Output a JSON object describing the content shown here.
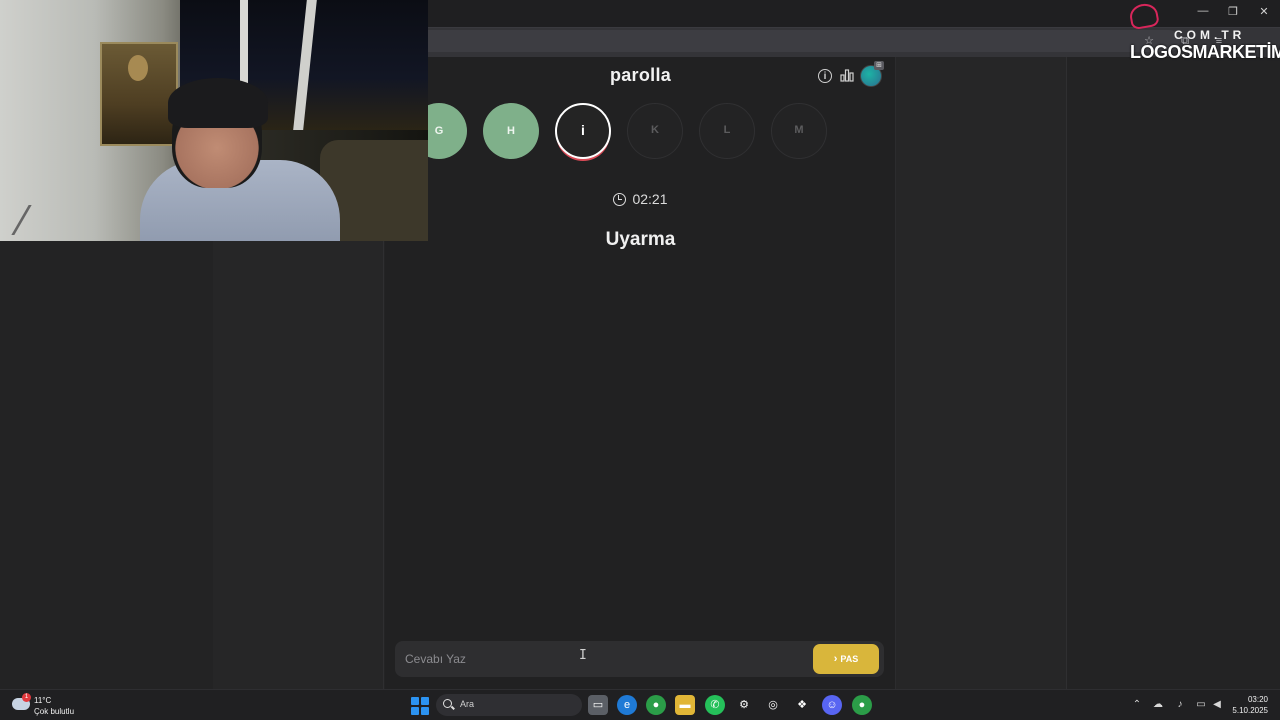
{
  "window": {
    "minimize_glyph": "—",
    "restore_glyph": "❐",
    "close_glyph": "✕"
  },
  "game": {
    "title": "parolla",
    "letters": [
      {
        "label": "",
        "state": "done"
      },
      {
        "label": "G",
        "state": "done"
      },
      {
        "label": "H",
        "state": "done"
      },
      {
        "label": "i",
        "state": "active"
      },
      {
        "label": "K",
        "state": "pending"
      },
      {
        "label": "L",
        "state": "pending"
      },
      {
        "label": "M",
        "state": "pending"
      }
    ],
    "timer": "02:21",
    "clue": "Uyarma",
    "answer_placeholder": "Cevabı Yaz",
    "pass_label": "PAS",
    "avatar_badge": "⊞"
  },
  "overlay": {
    "logo_suffix": "COM.TR",
    "logo_name": "LOGOSMARKETİM"
  },
  "taskbar": {
    "weather_temp": "11°C",
    "weather_desc": "Çok bulutlu",
    "weather_badge": "1",
    "search_placeholder": "Ara",
    "time": "03:20",
    "date": "5.10.2025"
  },
  "colors": {
    "done_letter": "#7fb08a",
    "active_ring": "#ffffff",
    "active_underline": "#d94a56",
    "pass_button": "#d9b63b",
    "page_bg": "#212122"
  }
}
